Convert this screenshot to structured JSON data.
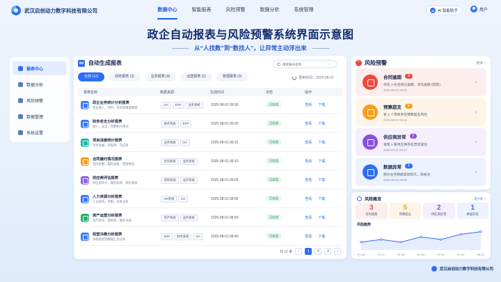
{
  "brand": {
    "name": "武汉启创动力数字科技有限公司"
  },
  "nav": {
    "items": [
      "数据中心",
      "智能报表",
      "风险预警",
      "数据分析",
      "系统管理"
    ]
  },
  "header": {
    "ai_label": "AI 智能助手",
    "ai_badge": "AI",
    "user_label": "用户"
  },
  "page": {
    "title": "政企自动报表与风险预警系统界面示意图",
    "subtitle": "从“人找数”到“数找人”，让异常主动浮出来"
  },
  "sidebar": {
    "items": [
      "报表中心",
      "数据分析",
      "风险预警",
      "数据管理",
      "系统设置"
    ]
  },
  "reports": {
    "title": "自动生成报表",
    "search_placeholder": "搜索报表名称...",
    "tabs": [
      "全部 (12)",
      "财务报表 (3)",
      "业务报表 (4)",
      "运营报表 (2)",
      "管理报表 (3)"
    ],
    "updated": "更新时间：2025-08-01",
    "headers": [
      "报表名称",
      "数据来源",
      "生成时间",
      "状态",
      "操作"
    ],
    "rows": [
      {
        "name": "政企业务统计分析报表",
        "desc": "营业收入、项目、合同等维度数据",
        "sources": [
          "OA",
          "ERP",
          "业务系统"
        ],
        "time": "2025-08-01 09:30",
        "status": "已完成",
        "color": "#3a7bf2"
      },
      {
        "name": "财务收支分析报表",
        "desc": "收入、支出、预算执行情况",
        "sources": [
          "财务系统",
          "ERP"
        ],
        "time": "2025-08-01 09:20",
        "status": "已完成",
        "color": "#3a7bf2"
      },
      {
        "name": "项目进度统计报表",
        "desc": "项目进展、里程碑、完成率",
        "sources": [
          "业务系统",
          "OA"
        ],
        "time": "2025-08-01 09:15",
        "status": "已完成",
        "color": "#1fb6a6"
      },
      {
        "name": "合同履约情况报表",
        "desc": "合同金额、履约进度、回款情况",
        "sources": [
          "合同系统",
          "业务系统"
        ],
        "time": "2025-08-01 09:10",
        "status": "已完成",
        "color": "#f59d1c"
      },
      {
        "name": "供应商评估报表",
        "desc": "供应商评分、履约表现、风险等级",
        "sources": [
          "采购系统",
          "业务系统"
        ],
        "time": "2025-08-01 09:05",
        "status": "已完成",
        "color": "#8a63e8"
      },
      {
        "name": "人力资源分析报表",
        "desc": "人员结构、考勤、成本分析",
        "sources": [
          "HR系统",
          "OA"
        ],
        "time": "2025-08-01 09:00",
        "status": "已完成",
        "color": "#3a7bf2"
      },
      {
        "name": "资产运营分析报表",
        "desc": "资产状况、使用率、维护记录",
        "sources": [
          "资产系统",
          "业务系统"
        ],
        "time": "2025-08-01 08:50",
        "status": "已完成",
        "color": "#22b06a"
      },
      {
        "name": "经营决策分析报表",
        "desc": "多维度经营数据汇总分析",
        "sources": [
          "ERP",
          "财务系统",
          "OA"
        ],
        "time": "2025-08-01 08:40",
        "status": "已完成",
        "color": "#3a7bf2"
      }
    ],
    "ops": [
      "查看",
      "下载"
    ],
    "pager": {
      "total": "共 12 条",
      "pages": [
        "1",
        "2",
        "3"
      ],
      "next": "›",
      "prev": "‹"
    }
  },
  "risk": {
    "title": "风险预警",
    "more": "更多 ›",
    "alerts": [
      {
        "name": "合同逾期",
        "count": "3",
        "desc": "存在 3 份合同已逾期，涉及金额 (较高)",
        "time": "2025-08-01 09:20",
        "color": "#ef4a3f",
        "bg": "#fdeeee"
      },
      {
        "name": "预算超支",
        "count": "5",
        "desc": "有 5 个项目存在预算超支风险",
        "time": "2025-08-01 09:15",
        "color": "#f59d1c",
        "bg": "#fef5e8"
      },
      {
        "name": "供应商异常",
        "count": "2",
        "desc": "发现 2 家供应商存在异常波动",
        "time": "2025-08-01 09:10",
        "color": "#8a4fe0",
        "bg": "#f4eefd"
      },
      {
        "name": "数据异常",
        "count": "1",
        "desc": "部分业务数据波动较大，请关注",
        "time": "2025-08-01 09:05",
        "color": "#2f6df6",
        "bg": "#ecf2fe"
      }
    ]
  },
  "overview": {
    "title": "风险概览",
    "more": "近7天 ›",
    "stats": [
      {
        "num": "3",
        "label": "合同逾期",
        "color": "#ef4a3f",
        "bg": "#fdeeee"
      },
      {
        "num": "5",
        "label": "预算超支",
        "color": "#f59d1c",
        "bg": "#fef5e8"
      },
      {
        "num": "2",
        "label": "供应商异常",
        "color": "#8a4fe0",
        "bg": "#f4eefd"
      },
      {
        "num": "1",
        "label": "数据异常",
        "color": "#2f6df6",
        "bg": "#ecf2fe"
      }
    ],
    "trend_title": "风险趋势",
    "chart_data": {
      "type": "area",
      "x": [
        "07-26",
        "07-27",
        "07-28",
        "07-29",
        "07-30",
        "07-31",
        "08-01"
      ],
      "values": [
        3,
        4,
        3,
        5,
        4,
        6,
        7
      ]
    }
  },
  "footer": {
    "brand": "武汉启创动力数字科技有限公司"
  }
}
